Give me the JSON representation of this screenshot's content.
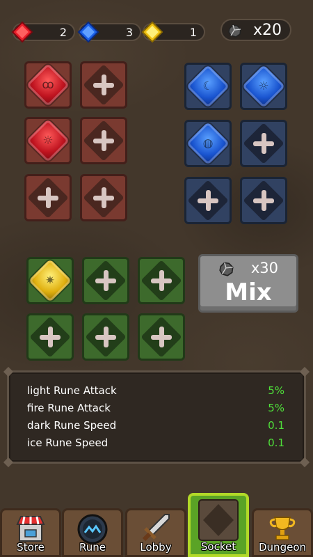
{
  "currencies": {
    "red": {
      "icon": "red-gem-icon",
      "count": "2"
    },
    "blue": {
      "icon": "blue-gem-icon",
      "count": "3"
    },
    "yellow": {
      "icon": "yellow-gem-icon",
      "count": "1"
    },
    "stone": {
      "icon": "stone-icon",
      "count": "x20"
    }
  },
  "rune_sets": {
    "fire": {
      "color": "#7a3a30",
      "filled": [
        "fire-rune-swirl",
        "fire-rune-sun"
      ],
      "empty_slots": 4
    },
    "ice": {
      "color": "#314262",
      "filled": [
        "ice-rune-moon",
        "ice-rune-sun",
        "ice-rune-drop"
      ],
      "empty_slots": 3
    },
    "light": {
      "color": "#3d6a2c",
      "filled": [
        "light-rune-star"
      ],
      "empty_slots": 5
    }
  },
  "mix": {
    "cost": "x30",
    "label": "Mix"
  },
  "stats": [
    {
      "name": "light Rune Attack",
      "value": "5%"
    },
    {
      "name": "fire Rune Attack",
      "value": "5%"
    },
    {
      "name": "dark Rune Speed",
      "value": "0.1"
    },
    {
      "name": "ice Rune Speed",
      "value": "0.1"
    }
  ],
  "nav": {
    "store": "Store",
    "rune": "Rune",
    "lobby": "Lobby",
    "socket": "Socket",
    "dungeon": "Dungeon",
    "active": "socket"
  },
  "colors": {
    "stat_value": "#4fe03a",
    "active_tab": "#5aa326"
  }
}
